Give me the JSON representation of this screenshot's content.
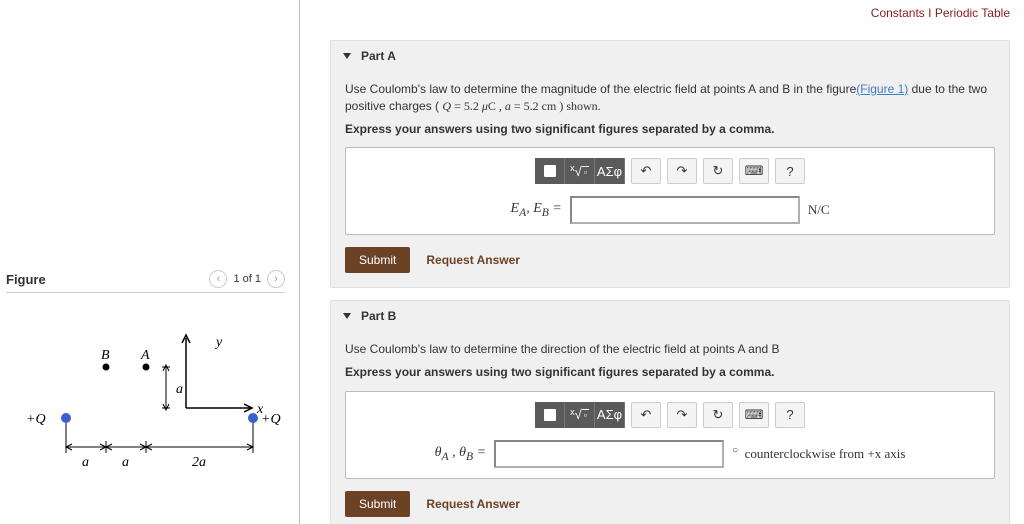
{
  "topLinks": {
    "constants": "Constants",
    "sep": " I ",
    "periodic": "Periodic Table"
  },
  "figure": {
    "title": "Figure",
    "page": "1 of 1"
  },
  "diagram": {
    "labels": {
      "B": "B",
      "A": "A",
      "y": "y",
      "x": "x",
      "plusQ": "+Q",
      "a": "a",
      "two_a": "2a"
    }
  },
  "partA": {
    "title": "Part A",
    "promptStart": "Use Coulomb's law to determine the magnitude of the electric field at points A and B in the figure",
    "figLink": "(Figure 1)",
    "promptEnd": " due to the two positive charges (",
    "given": "Q = 5.2 μC , a = 5.2 cm ) shown.",
    "instr": "Express your answers using two significant figures separated by a comma.",
    "ansLabel": "E_A, E_B =",
    "unit": "N/C",
    "submit": "Submit",
    "req": "Request Answer"
  },
  "partB": {
    "title": "Part B",
    "prompt": "Use Coulomb's law to determine the direction of the electric field at points A and B",
    "instr": "Express your answers using two significant figures separated by a comma.",
    "ansLabel": "θ_A , θ_B =",
    "unit": "counterclockwise from +x axis",
    "submit": "Submit",
    "req": "Request Answer"
  },
  "toolbar": {
    "root": "√",
    "greek": "ΑΣφ",
    "undo": "↶",
    "redo": "↷",
    "reset": "↻",
    "kbd": "⌨",
    "help": "?"
  }
}
